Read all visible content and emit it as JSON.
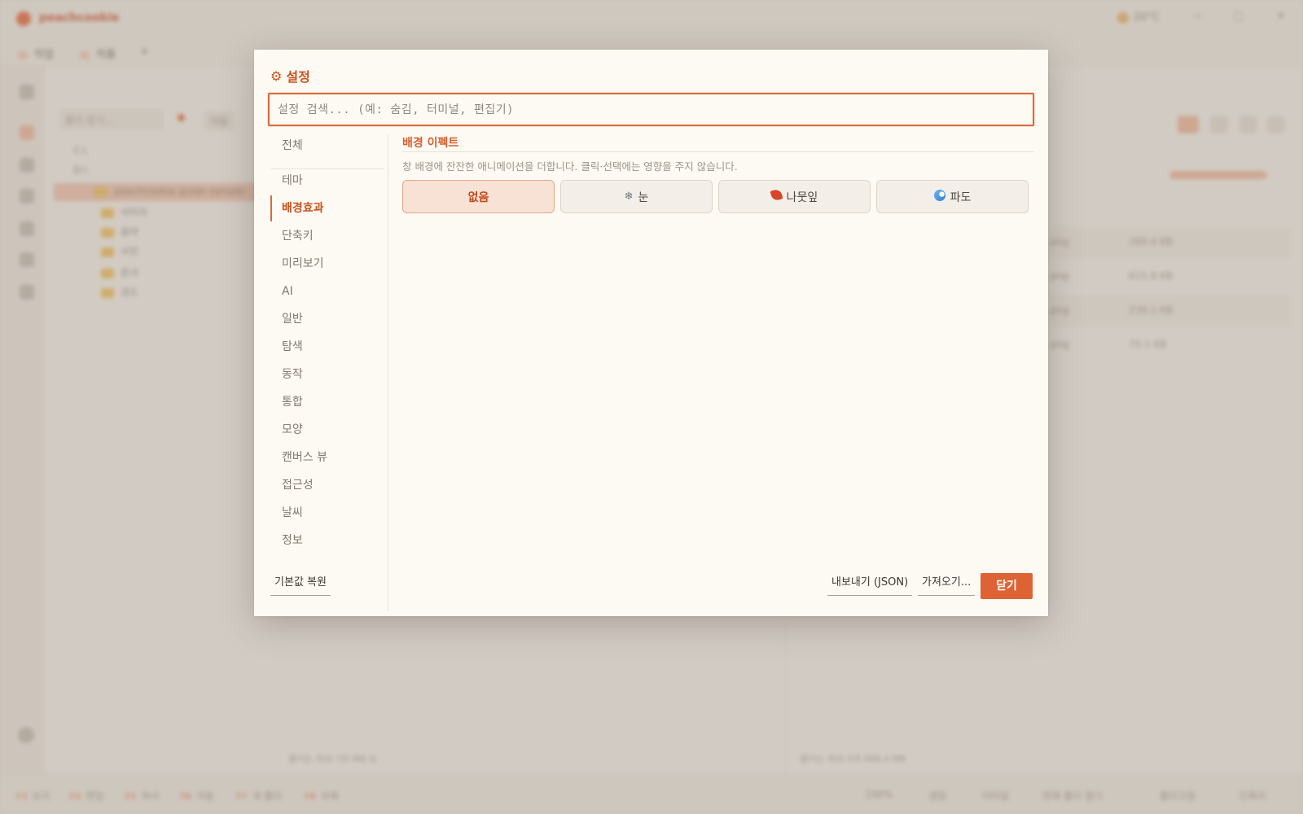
{
  "app": {
    "title": "peachcookie",
    "weather": "20°C",
    "tabs": [
      "작업",
      "작품"
    ],
    "left_search_placeholder": "폴더 찾기...",
    "left_filter": "자동",
    "tree": [
      "C:\\",
      "D:\\",
      "peachcookie guide sample",
      "이미지",
      "음악",
      "사진",
      "문서",
      "코드"
    ],
    "left_footer": "폴더는 최대 7천 MB 임",
    "right_footer": "폴더는 최대 4개 488.4 MB",
    "rows": [
      {
        "ext": ".png",
        "size": "289.4 KB"
      },
      {
        "ext": ".png",
        "size": "615.8 KB"
      },
      {
        "ext": ".png",
        "size": "239.1 KB"
      },
      {
        "ext": ".png",
        "size": "75.1 KB"
      }
    ],
    "status_items": [
      {
        "key": "F3",
        "label": "보기"
      },
      {
        "key": "F4",
        "label": "편집"
      },
      {
        "key": "F5",
        "label": "복사"
      },
      {
        "key": "F6",
        "label": "이동"
      },
      {
        "key": "F7",
        "label": "새 폴더"
      },
      {
        "key": "F8",
        "label": "삭제"
      }
    ],
    "status_right": [
      "100%",
      "경험",
      "터미널",
      "현재 폴더 열기",
      "폴더고정",
      "단축키"
    ]
  },
  "dialog": {
    "title": "설정",
    "search_placeholder": "설정 검색... (예: 숨김, 터미널, 편집기)",
    "nav": [
      "전체",
      "테마",
      "배경효과",
      "단축키",
      "미리보기",
      "AI",
      "일반",
      "탐색",
      "동작",
      "통합",
      "모양",
      "캔버스 뷰",
      "접근성",
      "날씨",
      "정보"
    ],
    "active_nav": "배경효과",
    "section": {
      "title": "배경 이펙트",
      "description": "창 배경에 잔잔한 애니메이션을 더합니다. 클릭·선택에는 영향을 주지 않습니다.",
      "options": [
        {
          "label": "없음",
          "icon": "",
          "selected": true
        },
        {
          "label": "눈",
          "icon": "snowflake-icon",
          "selected": false
        },
        {
          "label": "나뭇잎",
          "icon": "leaf-icon",
          "selected": false
        },
        {
          "label": "파도",
          "icon": "wave-icon",
          "selected": false
        }
      ]
    },
    "footer": {
      "reset": "기본값 복원",
      "export": "내보내기 (JSON)",
      "import": "가져오기...",
      "close": "닫기"
    },
    "colors": {
      "accent": "#dd6334",
      "selected_bg": "#f8e2d5"
    }
  }
}
